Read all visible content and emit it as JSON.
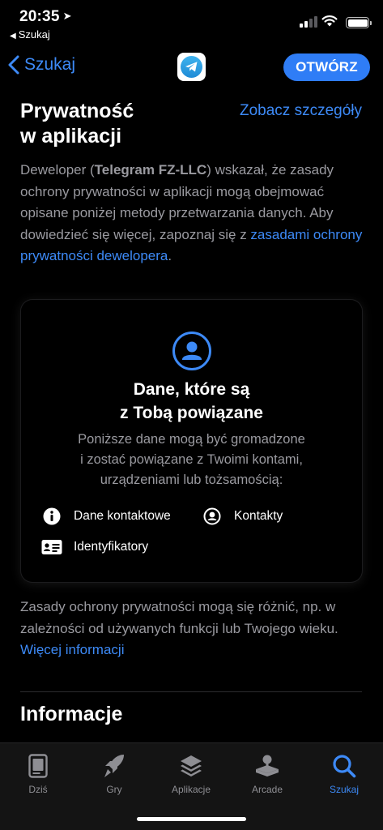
{
  "status_bar": {
    "time": "20:35",
    "back_app": "Szukaj"
  },
  "nav": {
    "back_label": "Szukaj",
    "open_button": "OTWÓRZ"
  },
  "privacy": {
    "title_line1": "Prywatność",
    "title_line2": "w aplikacji",
    "see_details": "Zobacz szczegóły",
    "intro_prefix": "Deweloper (",
    "developer": "Telegram FZ-LLC",
    "intro_middle": ") wskazał, że zasady ochrony prywatności w aplikacji mogą obejmować opisane poniżej metody przetwarzania danych. Aby dowiedzieć się więcej, zapoznaj się z ",
    "intro_link": "zasadami ochrony prywatności dewelopera",
    "intro_suffix": "."
  },
  "card": {
    "title_line1": "Dane, które są",
    "title_line2": "z Tobą powiązane",
    "desc_line1": "Poniższe dane mogą być gromadzone",
    "desc_line2": "i zostać powiązane z Twoimi kontami,",
    "desc_line3": "urządzeniami lub tożsamością:",
    "items": [
      {
        "label": "Dane kontaktowe",
        "icon": "info-circle-icon"
      },
      {
        "label": "Kontakty",
        "icon": "person-circle-icon"
      },
      {
        "label": "Identyfikatory",
        "icon": "id-card-icon"
      }
    ]
  },
  "footnote": {
    "text": "Zasady ochrony prywatności mogą się różnić, np. w zależności od używanych funkcji lub Twojego wieku. ",
    "link": "Więcej informacji"
  },
  "information": {
    "title": "Informacje"
  },
  "tab_bar": {
    "tabs": [
      {
        "label": "Dziś",
        "icon": "today-icon",
        "active": false
      },
      {
        "label": "Gry",
        "icon": "rocket-icon",
        "active": false
      },
      {
        "label": "Aplikacje",
        "icon": "layers-icon",
        "active": false
      },
      {
        "label": "Arcade",
        "icon": "joystick-icon",
        "active": false
      },
      {
        "label": "Szukaj",
        "icon": "search-icon",
        "active": true
      }
    ]
  },
  "colors": {
    "accent": "#3d8af7",
    "background": "#000000",
    "secondary_text": "#9a9aa0"
  }
}
